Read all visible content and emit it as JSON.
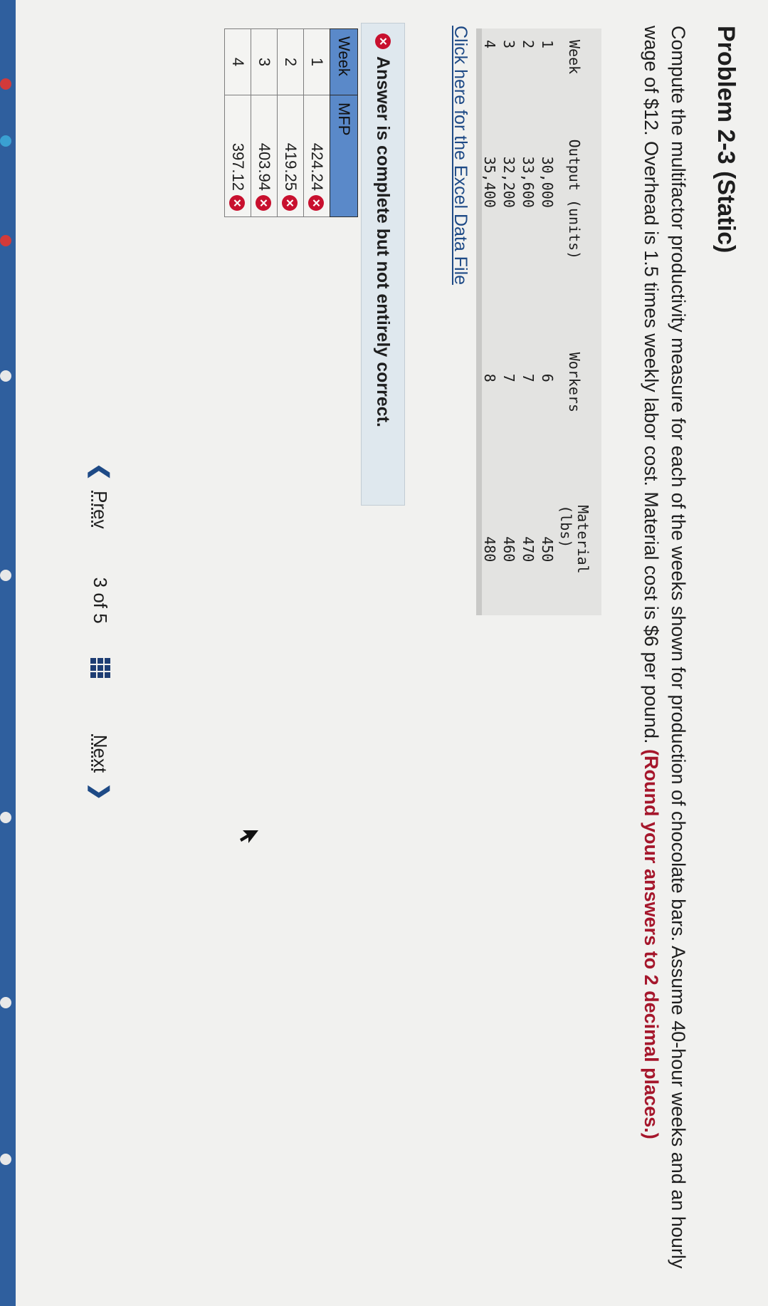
{
  "page": {
    "title": "Problem 2-3 (Static)",
    "instructions": "Compute the multifactor productivity measure for each of the weeks shown for production of chocolate bars. Assume 40-hour weeks and an hourly wage of $12. Overhead is 1.5 times weekly labor cost. Material cost is $6 per pound.",
    "instructions_emphasis": "(Round your answers to 2 decimal places.)"
  },
  "data_table": {
    "headers": [
      "Week",
      "Output (units)",
      "Workers",
      "Material (lbs)"
    ],
    "rows": [
      [
        "1",
        "30,000",
        "6",
        "450"
      ],
      [
        "2",
        "33,600",
        "7",
        "470"
      ],
      [
        "3",
        "32,200",
        "7",
        "460"
      ],
      [
        "4",
        "35,400",
        "8",
        "480"
      ]
    ]
  },
  "excel_link": "Click here for the Excel Data File",
  "feedback": {
    "message": "Answer is complete but not entirely correct.",
    "status_color": "#c8102e"
  },
  "answer_table": {
    "headers": [
      "Week",
      "MFP"
    ],
    "rows": [
      {
        "week": "1",
        "mfp": "424.24",
        "status": "incorrect"
      },
      {
        "week": "2",
        "mfp": "419.25",
        "status": "incorrect"
      },
      {
        "week": "3",
        "mfp": "403.94",
        "status": "incorrect"
      },
      {
        "week": "4",
        "mfp": "397.12",
        "status": "incorrect"
      }
    ]
  },
  "navigation": {
    "prev_label": "Prev",
    "page_current": "3",
    "page_of": "of",
    "page_total": "5",
    "next_label": "Next",
    "grid_icon": "grid-menu-icon"
  },
  "colors": {
    "emphasis": "#a5162b",
    "header_blue": "#5a89c9",
    "link_blue": "#1e4a86"
  }
}
